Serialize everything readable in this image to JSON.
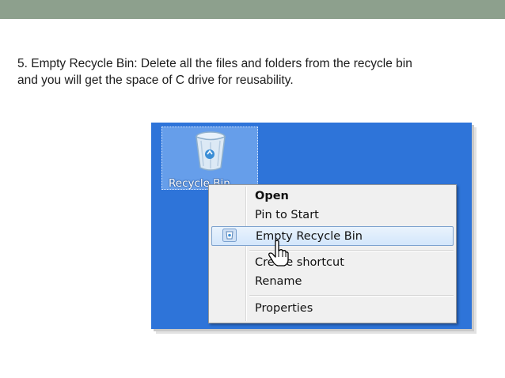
{
  "slide": {
    "text_line1": "5. Empty Recycle Bin: Delete all the files and folders from the recycle bin",
    "text_line2": "and you will get the space of C drive for reusability."
  },
  "desktop": {
    "icon_label": "Recycle Bin",
    "icon_name": "recycle-bin-icon",
    "background_color": "#2e74d9"
  },
  "context_menu": {
    "items": [
      {
        "label": "Open",
        "bold": true
      },
      {
        "label": "Pin to Start"
      },
      {
        "label": "Empty Recycle Bin",
        "highlighted": true,
        "icon": "recycle-bin-small-icon"
      },
      {
        "label": "Create shortcut"
      },
      {
        "label": "Rename"
      },
      {
        "label": "Properties"
      }
    ]
  },
  "colors": {
    "top_bar": "#8da08d",
    "menu_highlight_border": "#7da2ce"
  }
}
